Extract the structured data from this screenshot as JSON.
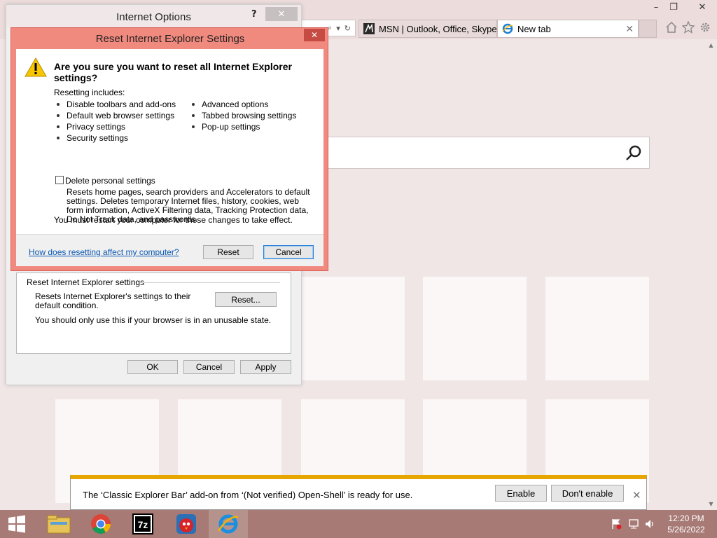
{
  "browser": {
    "tabs": [
      {
        "label": "MSN | Outlook, Office, Skype, ...",
        "icon": "msn-icon"
      },
      {
        "label": "New tab",
        "icon": "ie-icon"
      }
    ],
    "window_controls": [
      "minimize",
      "restore",
      "close"
    ]
  },
  "internet_options": {
    "title": "Internet Options",
    "help": "?",
    "reset_group": {
      "legend": "Reset Internet Explorer settings",
      "description": "Resets Internet Explorer's settings to their default condition.",
      "note": "You should only use this if your browser is in an unusable state.",
      "reset_button": "Reset..."
    },
    "buttons": {
      "ok": "OK",
      "cancel": "Cancel",
      "apply": "Apply"
    }
  },
  "reset_dialog": {
    "title": "Reset Internet Explorer Settings",
    "heading": "Are you sure you want to reset all Internet Explorer settings?",
    "includes_label": "Resetting includes:",
    "items_left": [
      "Disable toolbars and add-ons",
      "Default web browser settings",
      "Privacy settings",
      "Security settings"
    ],
    "items_right": [
      "Advanced options",
      "Tabbed browsing settings",
      "Pop-up settings"
    ],
    "checkbox_label": "Delete personal settings",
    "checkbox_checked": false,
    "checkbox_description": "Resets home pages, search providers and Accelerators to default settings. Deletes temporary Internet files, history, cookies, web form information, ActiveX Filtering data, Tracking Protection data, Do Not Track data, and passwords.",
    "restart_note": "You must restart your computer for these changes to take effect.",
    "help_link": "How does resetting affect my computer?",
    "reset_button": "Reset",
    "cancel_button": "Cancel"
  },
  "notification": {
    "text": "The ‘Classic Explorer Bar’ add-on from ‘(Not verified) Open-Shell’ is ready for use.",
    "enable_button": "Enable",
    "dont_enable_button": "Don't enable"
  },
  "taskbar": {
    "apps": [
      "file-explorer",
      "chrome",
      "7zip",
      "angry-birds",
      "internet-explorer"
    ],
    "time": "12:20 PM",
    "date": "5/26/2022"
  },
  "colors": {
    "accent_dialog": "#f0897e",
    "taskbar": "#a77a75",
    "notification_bar": "#e7a500",
    "link": "#0b59b3"
  }
}
